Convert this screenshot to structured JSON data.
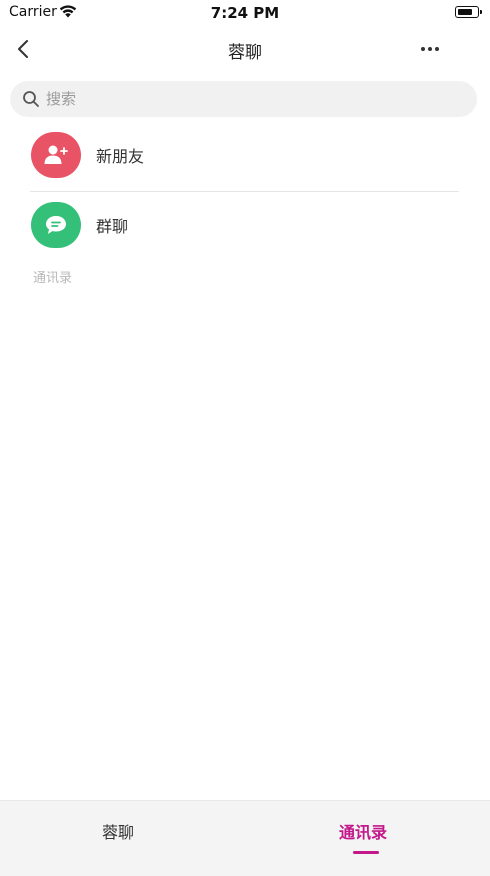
{
  "status_bar": {
    "carrier": "Carrier",
    "time": "7:24 PM"
  },
  "nav": {
    "title": "蓉聊",
    "back_icon": "chevron-left-icon",
    "more_icon": "ellipsis-icon"
  },
  "search": {
    "placeholder": "搜索",
    "value": ""
  },
  "list": {
    "items": [
      {
        "label": "新朋友",
        "icon": "add-user-icon",
        "color": "#e85466"
      },
      {
        "label": "群聊",
        "icon": "chat-bubble-icon",
        "color": "#35c07a"
      }
    ],
    "section_label": "通讯录"
  },
  "tabs": [
    {
      "label": "蓉聊",
      "active": false
    },
    {
      "label": "通讯录",
      "active": true,
      "color": "#c2188a"
    }
  ]
}
